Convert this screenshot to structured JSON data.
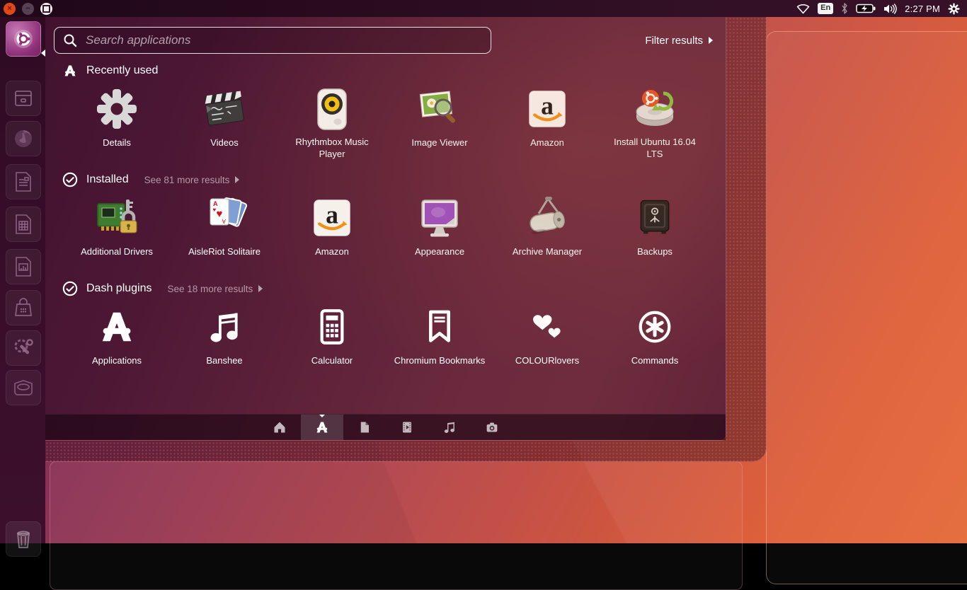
{
  "topbar": {
    "window_controls": {
      "close": "close-button",
      "minimize": "minimize-button",
      "maximize": "maximize-button"
    },
    "status_icons": [
      "network-wifi-icon",
      "keyboard-layout-indicator",
      "bluetooth-icon",
      "battery-charging-icon",
      "volume-icon",
      "clock",
      "session-gear-icon"
    ],
    "keyboard_indicator": "En",
    "time": "2:27 PM"
  },
  "launcher": {
    "items": [
      {
        "name": "ubuntu-dash-button",
        "icon": "ubuntu-logo-icon"
      },
      {
        "name": "files",
        "icon": "file-cabinet-icon"
      },
      {
        "name": "firefox",
        "icon": "firefox-icon"
      },
      {
        "name": "libreoffice-writer",
        "icon": "writer-document-icon"
      },
      {
        "name": "libreoffice-calc",
        "icon": "spreadsheet-icon"
      },
      {
        "name": "libreoffice-impress",
        "icon": "presentation-icon"
      },
      {
        "name": "ubuntu-software",
        "icon": "software-bag-icon"
      },
      {
        "name": "system-settings",
        "icon": "gear-wrench-icon"
      },
      {
        "name": "install-ubuntu",
        "icon": "hard-disk-icon"
      },
      {
        "name": "trash",
        "icon": "trash-icon"
      }
    ]
  },
  "dash": {
    "search": {
      "placeholder": "Search applications",
      "icon": "search-icon"
    },
    "filter": {
      "label": "Filter results",
      "icon": "arrow-right-icon"
    },
    "sections": [
      {
        "title": "Recently used",
        "header_icon": "applications-lens-icon",
        "more": "",
        "items": [
          {
            "label": "Details",
            "icon": "gear-icon"
          },
          {
            "label": "Videos",
            "icon": "clapperboard-icon"
          },
          {
            "label": "Rhythmbox Music Player",
            "icon": "speaker-icon"
          },
          {
            "label": "Image Viewer",
            "icon": "photo-magnifier-icon"
          },
          {
            "label": "Amazon",
            "icon": "amazon-icon"
          },
          {
            "label": "Install Ubuntu 16.04 LTS",
            "icon": "install-disk-icon"
          }
        ]
      },
      {
        "title": "Installed",
        "header_icon": "check-circle-icon",
        "more": "See 81 more results",
        "items": [
          {
            "label": "Additional Drivers",
            "icon": "circuit-lock-icon"
          },
          {
            "label": "AisleRiot Solitaire",
            "icon": "playing-cards-icon"
          },
          {
            "label": "Amazon",
            "icon": "amazon-icon"
          },
          {
            "label": "Appearance",
            "icon": "monitor-icon"
          },
          {
            "label": "Archive Manager",
            "icon": "roller-press-icon"
          },
          {
            "label": "Backups",
            "icon": "safe-icon"
          }
        ]
      },
      {
        "title": "Dash plugins",
        "header_icon": "check-circle-icon",
        "more": "See 18 more results",
        "items": [
          {
            "label": "Applications",
            "icon": "applications-lens-icon"
          },
          {
            "label": "Banshee",
            "icon": "music-note-icon"
          },
          {
            "label": "Calculator",
            "icon": "calculator-icon"
          },
          {
            "label": "Chromium Bookmarks",
            "icon": "bookmark-icon"
          },
          {
            "label": "COLOURlovers",
            "icon": "hearts-icon"
          },
          {
            "label": "Commands",
            "icon": "asterisk-circle-icon"
          }
        ]
      }
    ],
    "lens_bar": {
      "tabs": [
        {
          "name": "home-lens",
          "icon": "home-icon",
          "active": false
        },
        {
          "name": "applications-lens",
          "icon": "applications-lens-icon",
          "active": true
        },
        {
          "name": "files-lens",
          "icon": "document-icon",
          "active": false
        },
        {
          "name": "videos-lens",
          "icon": "video-icon",
          "active": false
        },
        {
          "name": "music-lens",
          "icon": "music-note-icon",
          "active": false
        },
        {
          "name": "photos-lens",
          "icon": "camera-icon",
          "active": false
        }
      ]
    }
  },
  "colors": {
    "accent_orange": "#E95420",
    "panel_bg": "#2B0A1E",
    "dash_purple": "#4C1734",
    "dash_maroon": "#6C2A3E",
    "wallpaper_orange": "#E4622E",
    "wallpaper_purple": "#6D2A5E"
  }
}
